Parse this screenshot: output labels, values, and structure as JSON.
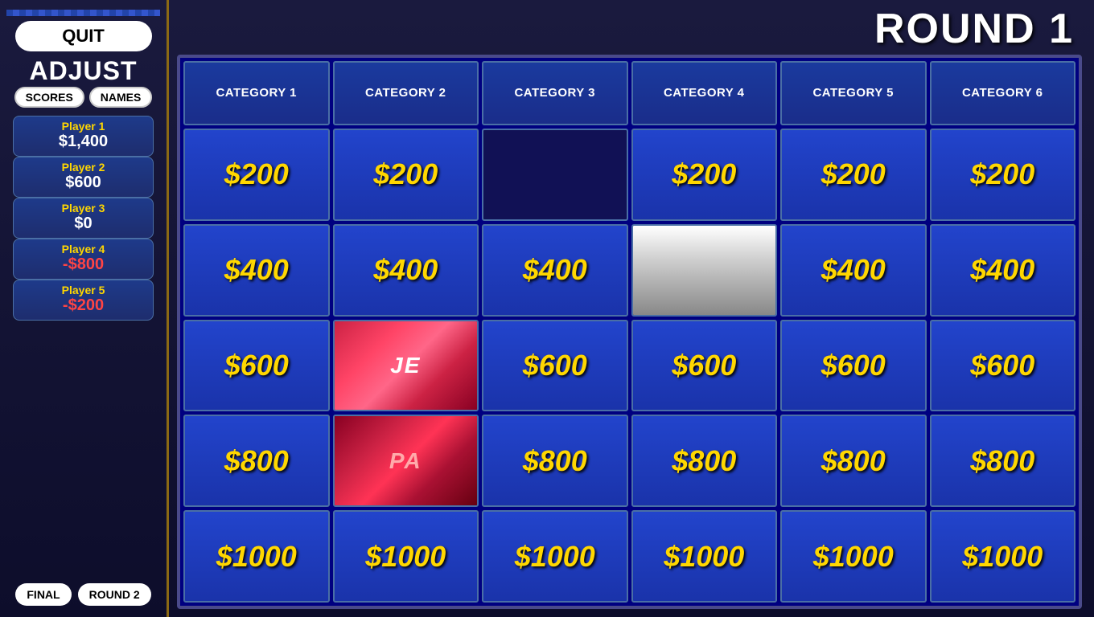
{
  "sidebar": {
    "quit_label": "QUIT",
    "adjust_label": "ADJUST",
    "scores_label": "SCORES",
    "names_label": "NAMES",
    "players": [
      {
        "name": "Player 1",
        "score": "$1,400",
        "negative": false
      },
      {
        "name": "Player 2",
        "score": "$600",
        "negative": false
      },
      {
        "name": "Player 3",
        "score": "$0",
        "negative": false
      },
      {
        "name": "Player 4",
        "score": "-$800",
        "negative": true
      },
      {
        "name": "Player 5",
        "score": "-$200",
        "negative": true
      }
    ],
    "final_label": "FINAL",
    "round2_label": "ROUND 2"
  },
  "board": {
    "round_title": "ROUND 1",
    "categories": [
      "CATEGORY 1",
      "CATEGORY 2",
      "CATEGORY 3",
      "CATEGORY 4",
      "CATEGORY 5",
      "CATEGORY 6"
    ],
    "rows": [
      {
        "values": [
          "$200",
          "$200",
          null,
          "$200",
          "$200",
          "$200"
        ],
        "used": [
          false,
          false,
          true,
          false,
          false,
          false
        ],
        "special": [
          false,
          false,
          "dark",
          false,
          false,
          false
        ]
      },
      {
        "values": [
          "$400",
          "$400",
          "$400",
          null,
          "$400",
          "$400"
        ],
        "used": [
          false,
          false,
          false,
          true,
          false,
          false
        ],
        "special": [
          false,
          false,
          false,
          "image",
          false,
          false
        ]
      },
      {
        "values": [
          "$600",
          null,
          "$600",
          "$600",
          "$600",
          "$600"
        ],
        "used": [
          false,
          true,
          false,
          false,
          false,
          false
        ],
        "special": [
          false,
          "image-red",
          false,
          false,
          false,
          false
        ]
      },
      {
        "values": [
          "$800",
          null,
          "$800",
          "$800",
          "$800",
          "$800"
        ],
        "used": [
          false,
          true,
          false,
          false,
          false,
          false
        ],
        "special": [
          false,
          "image-red-dark",
          false,
          false,
          false,
          false
        ]
      },
      {
        "values": [
          "$1000",
          "$1000",
          "$1000",
          "$1000",
          "$1000",
          "$1000"
        ],
        "used": [
          false,
          false,
          false,
          false,
          false,
          false
        ],
        "special": [
          false,
          false,
          false,
          false,
          false,
          false
        ]
      }
    ]
  }
}
